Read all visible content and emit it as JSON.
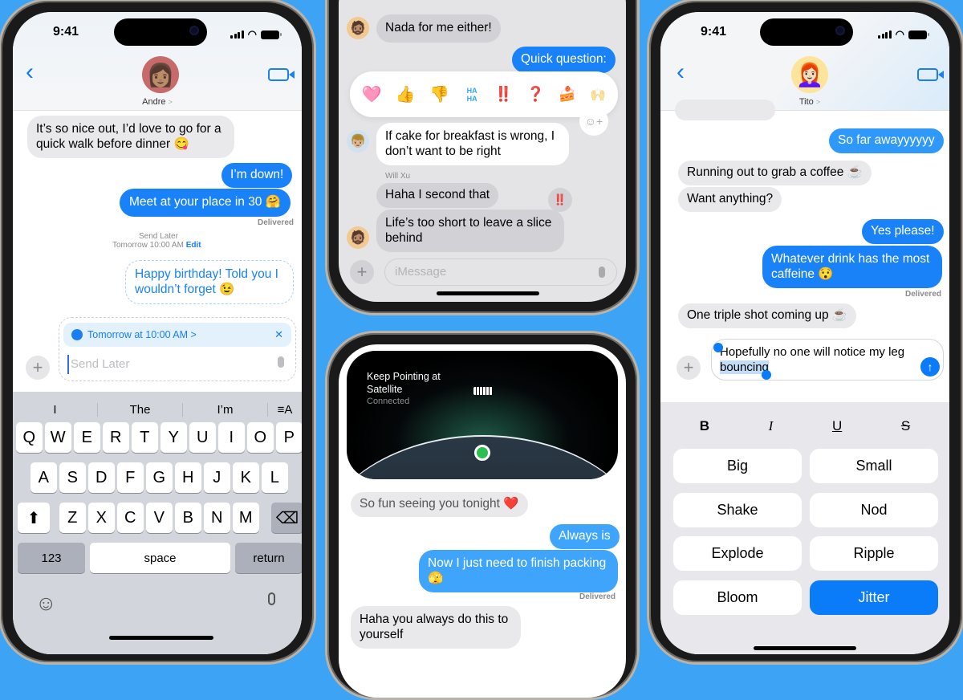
{
  "colors": {
    "background": "#3ca3f5",
    "accent": "#1a82f9",
    "bubble_in": "#e9e9eb"
  },
  "phone_left": {
    "status_time": "9:41",
    "contact_name": "Andre",
    "contact_chevron": ">",
    "back_icon": "‹",
    "messages": [
      {
        "from": "them",
        "text": "It’s so nice out, I’d love to go for a quick walk before dinner 😋"
      },
      {
        "from": "me",
        "text": "I’m down!"
      },
      {
        "from": "me",
        "text": "Meet at your place in 30 🤗"
      }
    ],
    "delivered": "Delivered",
    "send_later_label": "Send Later",
    "send_later_time": "Tomorrow 10:00 AM",
    "send_later_edit": "Edit",
    "scheduled_message": "Happy birthday! Told you I wouldn’t forget 😉",
    "schedule_chip": "Tomorrow at 10:00 AM >",
    "schedule_close": "✕",
    "input_placeholder": "Send Later",
    "suggestions": [
      "I",
      "The",
      "I’m"
    ],
    "suggest_format_icon": "≡A",
    "keyboard": {
      "row1": [
        "Q",
        "W",
        "E",
        "R",
        "T",
        "Y",
        "U",
        "I",
        "O",
        "P"
      ],
      "row2": [
        "A",
        "S",
        "D",
        "F",
        "G",
        "H",
        "J",
        "K",
        "L"
      ],
      "row3": [
        "Z",
        "X",
        "C",
        "V",
        "B",
        "N",
        "M"
      ],
      "numbers": "123",
      "space": "space",
      "return": "return",
      "shift_icon": "⬆",
      "delete_icon": "⌫"
    },
    "emoji_icon": "☺",
    "mic_icon": "🎙"
  },
  "phone_top_middle": {
    "messages": [
      {
        "from": "them",
        "text": "Nada for me either!"
      },
      {
        "from": "me",
        "text": "Quick question:"
      },
      {
        "from": "them",
        "text": "If cake for breakfast is wrong, I don’t want to be right"
      },
      {
        "from": "them",
        "sender": "Will Xu",
        "text": "Haha I second that"
      },
      {
        "from": "them",
        "text": "Life’s too short to leave a slice behind"
      }
    ],
    "tapbacks": [
      "🩷",
      "👍",
      "👎",
      "HA HA",
      "‼️",
      "❓",
      "🍰",
      "🙌"
    ],
    "add_emoji_icon": "☺+",
    "reaction_badge": "‼️",
    "input_placeholder": "iMessage"
  },
  "phone_bottom_middle": {
    "satellite_title": "Keep Pointing at Satellite",
    "satellite_status": "Connected",
    "messages": [
      {
        "from": "them",
        "text": "So fun seeing you tonight ❤️"
      },
      {
        "from": "me",
        "text": "Always is"
      },
      {
        "from": "me",
        "text": "Now I just need to finish packing 🫣"
      },
      {
        "from": "them",
        "text": "Haha you always do this to yourself"
      }
    ],
    "delivered": "Delivered"
  },
  "phone_right": {
    "status_time": "9:41",
    "contact_name": "Tito",
    "contact_chevron": ">",
    "messages": [
      {
        "from": "me",
        "text": "So far awayyyyyy"
      },
      {
        "from": "them",
        "text": "Running out to grab a coffee ☕"
      },
      {
        "from": "them",
        "text": "Want anything?"
      },
      {
        "from": "me",
        "text": "Yes please!"
      },
      {
        "from": "me",
        "text": "Whatever drink has the most caffeine 😯"
      },
      {
        "from": "them",
        "text": "One triple shot coming up ☕"
      }
    ],
    "delivered": "Delivered",
    "draft_text_before": "Hopefully no one will notice my leg ",
    "draft_selected": "bouncing",
    "format_buttons": [
      "B",
      "I",
      "U",
      "S"
    ],
    "effects": [
      {
        "label": "Big",
        "selected": false
      },
      {
        "label": "Small",
        "selected": false
      },
      {
        "label": "Shake",
        "selected": false
      },
      {
        "label": "Nod",
        "selected": false
      },
      {
        "label": "Explode",
        "selected": false
      },
      {
        "label": "Ripple",
        "selected": false
      },
      {
        "label": "Bloom",
        "selected": false
      },
      {
        "label": "Jitter",
        "selected": true
      }
    ]
  }
}
